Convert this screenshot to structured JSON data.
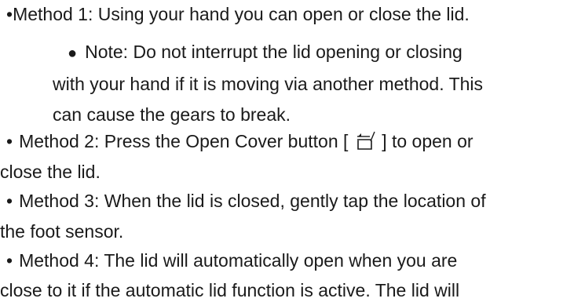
{
  "doc": {
    "m1": {
      "bullet": "•",
      "text": "Method 1: Using your hand you can open or close the lid."
    },
    "note": {
      "bullet": "●",
      "lines": [
        "Note: Do not interrupt the lid opening or closing",
        "with your hand if it is moving via another method. This",
        "can cause the gears to break."
      ]
    },
    "m2": {
      "bullet": "•",
      "before_icon": "Method 2: Press the Open Cover button [",
      "after_icon": "] to open or",
      "cont": "close the lid.",
      "icon": "open-cover-icon"
    },
    "m3": {
      "bullet": "•",
      "line1": "Method 3: When the lid is closed, gently tap the location of",
      "line2": "the foot sensor."
    },
    "m4": {
      "bullet": "•",
      "line1": "Method 4: The lid will automatically open when you are",
      "line2": "close to it if the automatic lid function is active. The lid will"
    }
  }
}
